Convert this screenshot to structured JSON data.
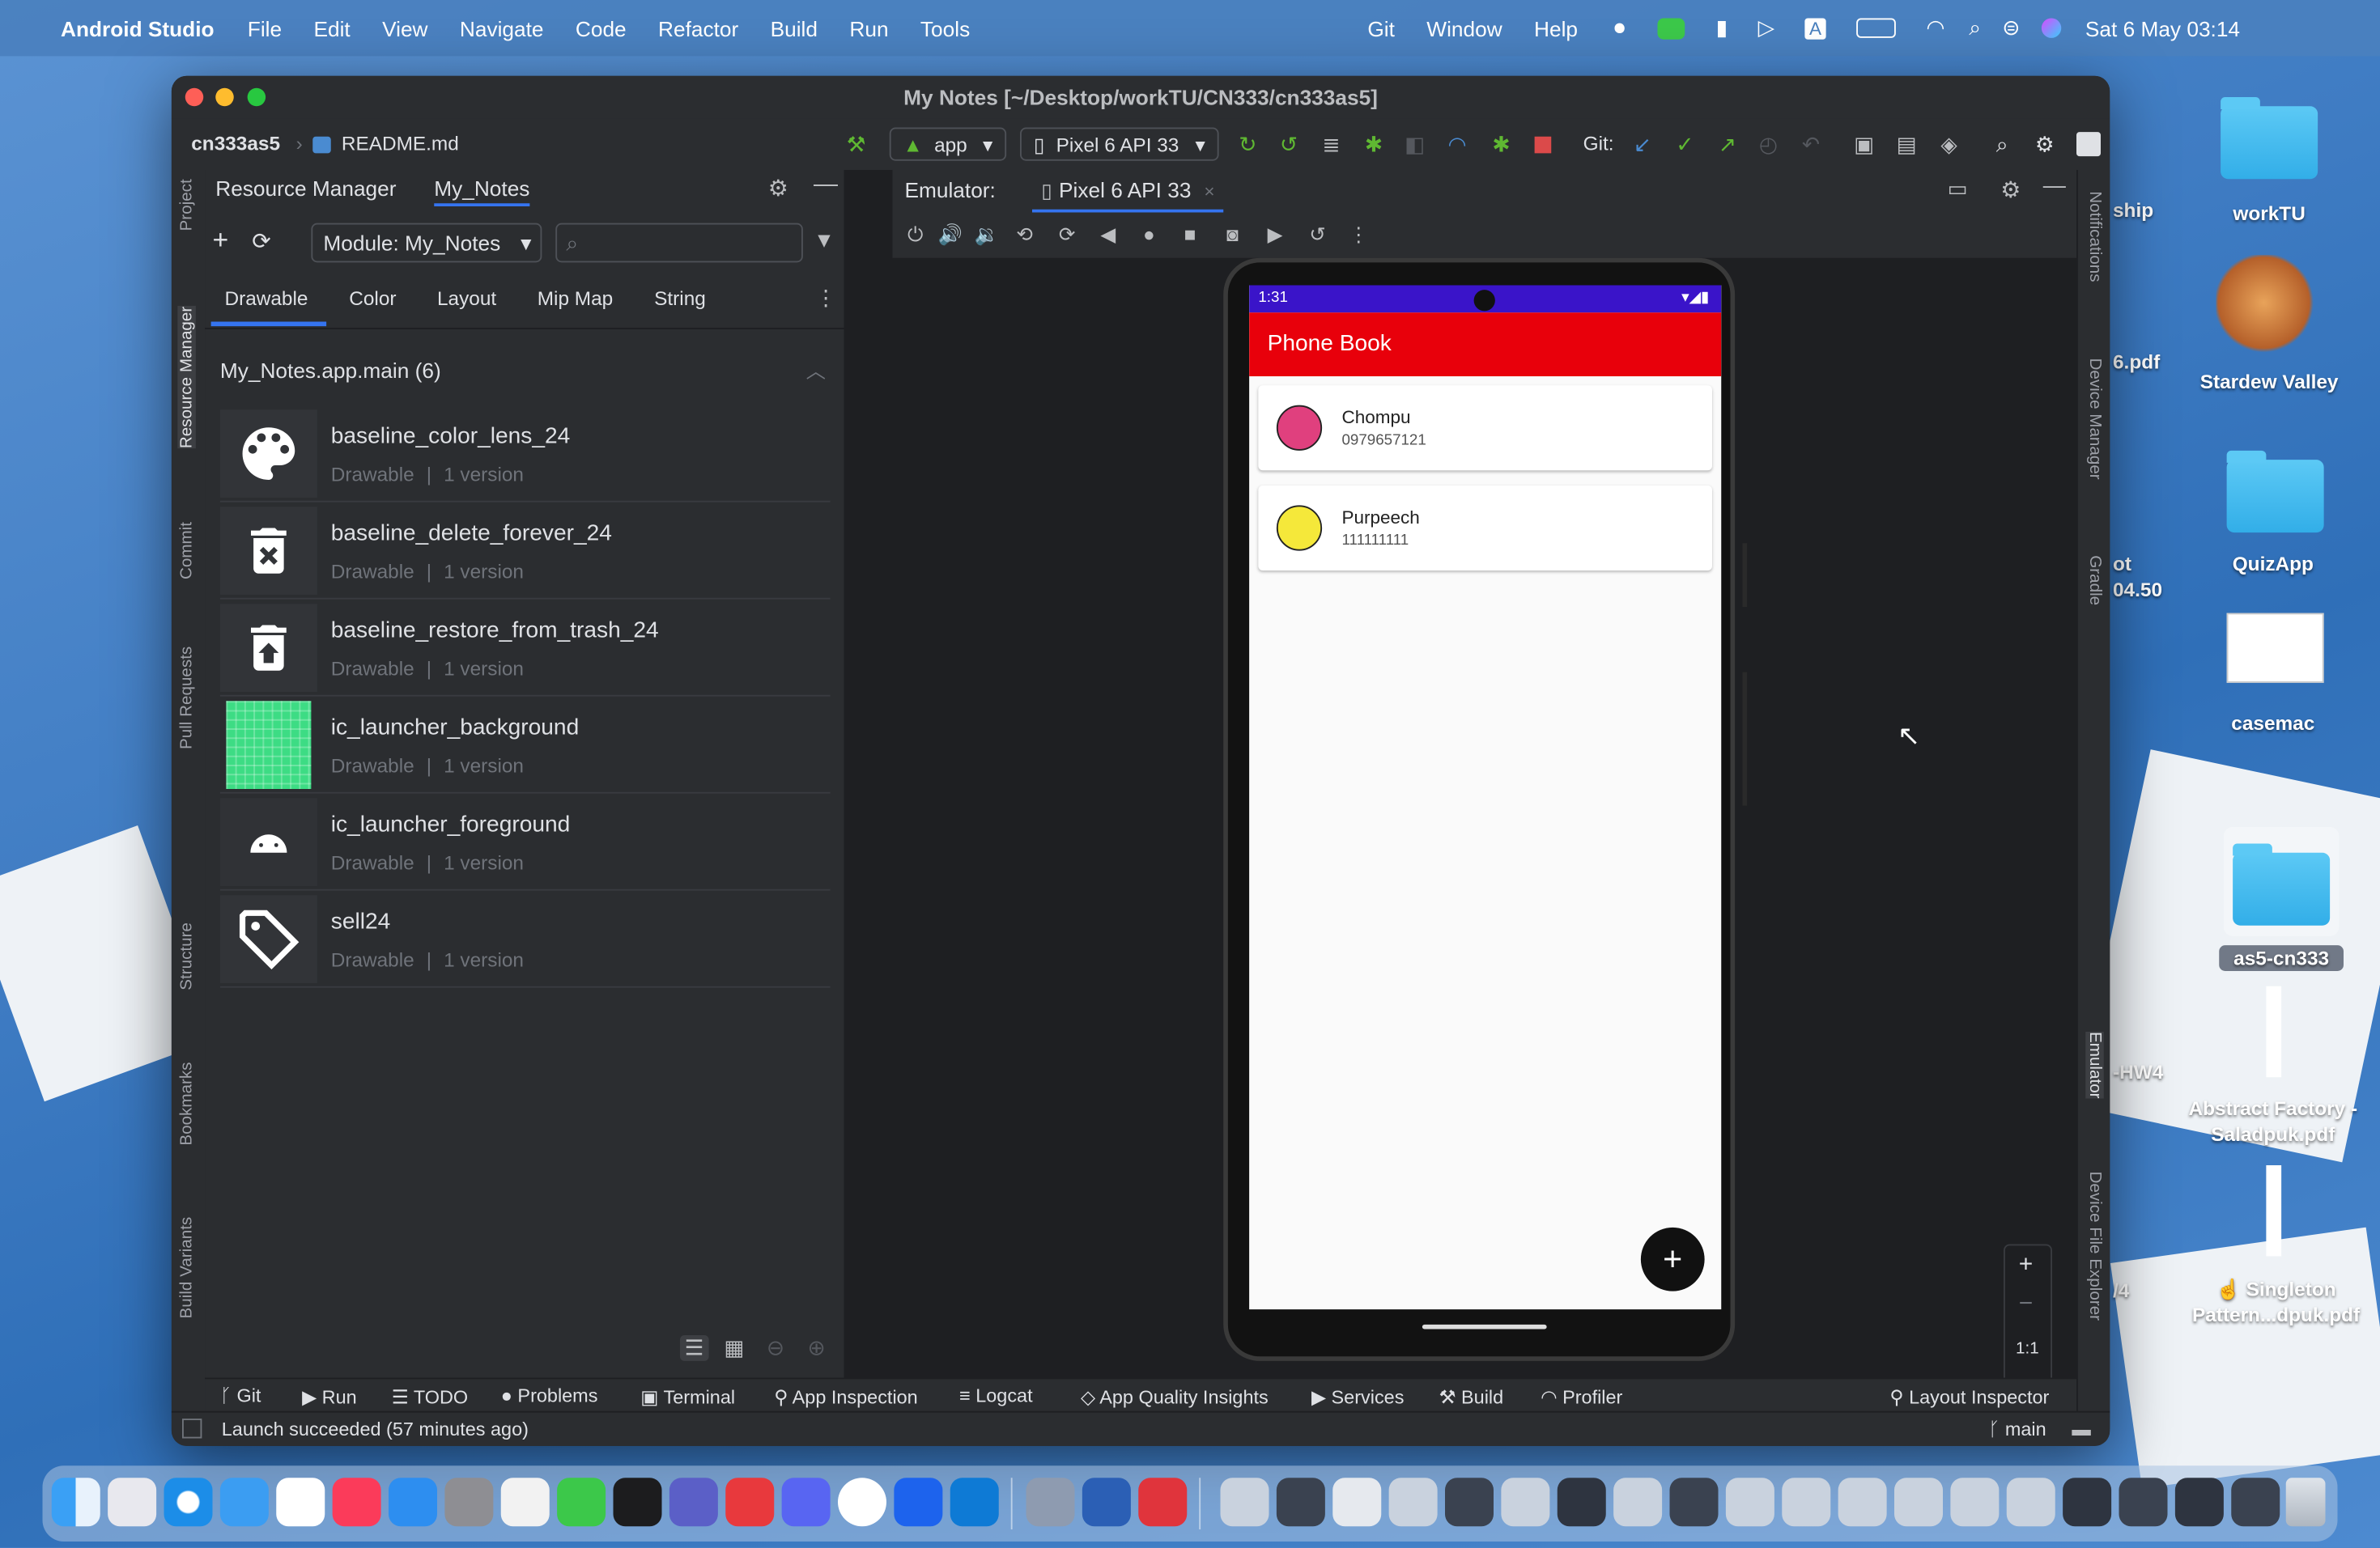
{
  "menubar": {
    "app_name": "Android Studio",
    "items": [
      "File",
      "Edit",
      "View",
      "Navigate",
      "Code",
      "Refactor",
      "Build",
      "Run",
      "Tools"
    ],
    "right_items": [
      "Git",
      "Window",
      "Help"
    ],
    "datetime": "Sat 6 May  03:14"
  },
  "window": {
    "title": "My Notes [~/Desktop/workTU/CN333/cn333as5]",
    "breadcrumb": [
      "cn333as5",
      "README.md"
    ],
    "run_config": "app",
    "device": "Pixel 6 API 33",
    "git_label": "Git:"
  },
  "left_stripe": [
    "Project",
    "Resource Manager",
    "Commit",
    "Pull Requests",
    "Structure",
    "Bookmarks",
    "Build Variants"
  ],
  "right_stripe": [
    "Notifications",
    "Device Manager",
    "Gradle",
    "Emulator",
    "Device File Explorer"
  ],
  "resource_manager": {
    "tabs": [
      "Resource Manager",
      "My_Notes"
    ],
    "module": "Module: My_Notes",
    "type_tabs": [
      "Drawable",
      "Color",
      "Layout",
      "Mip Map",
      "String"
    ],
    "active_type_tab": "Drawable",
    "group_title": "My_Notes.app.main (6)",
    "items": [
      {
        "name": "baseline_color_lens_24",
        "type": "Drawable",
        "versions": "1 version",
        "icon": "palette-icon"
      },
      {
        "name": "baseline_delete_forever_24",
        "type": "Drawable",
        "versions": "1 version",
        "icon": "delete-forever-icon"
      },
      {
        "name": "baseline_restore_from_trash_24",
        "type": "Drawable",
        "versions": "1 version",
        "icon": "restore-from-trash-icon"
      },
      {
        "name": "ic_launcher_background",
        "type": "Drawable",
        "versions": "1 version",
        "icon": "green-grid-icon"
      },
      {
        "name": "ic_launcher_foreground",
        "type": "Drawable",
        "versions": "1 version",
        "icon": "android-icon"
      },
      {
        "name": "sell24",
        "type": "Drawable",
        "versions": "1 version",
        "icon": "tag-icon"
      }
    ]
  },
  "emulator": {
    "label": "Emulator:",
    "tab": "Pixel 6 API 33",
    "zoom_label": "1:1",
    "phone": {
      "time": "1:31",
      "app_title": "Phone Book",
      "contacts": [
        {
          "name": "Chompu",
          "phone": "0979657121",
          "color": "#e0407e"
        },
        {
          "name": "Purpeech",
          "phone": "111111111",
          "color": "#f5e83a"
        }
      ],
      "fab": "+"
    }
  },
  "bottom_tools": [
    "Git",
    "Run",
    "TODO",
    "Problems",
    "Terminal",
    "App Inspection",
    "Logcat",
    "App Quality Insights",
    "Services",
    "Build",
    "Profiler"
  ],
  "layout_inspector": "Layout Inspector",
  "status": {
    "message": "Launch succeeded (57 minutes ago)",
    "branch": "main"
  },
  "desktop_icons": [
    {
      "label": "workTU"
    },
    {
      "label": "Stardew Valley"
    },
    {
      "label": "QuizApp"
    },
    {
      "label": "casemac"
    },
    {
      "label": "as5-cn333"
    },
    {
      "label": "Abstract Factory - Saladpuk.pdf"
    },
    {
      "label": "☝️ Singleton Pattern...dpuk.pdf"
    }
  ],
  "desktop_partial": [
    "ship",
    "6.pdf",
    "ot",
    "04.50",
    "-HW4",
    "/4"
  ]
}
